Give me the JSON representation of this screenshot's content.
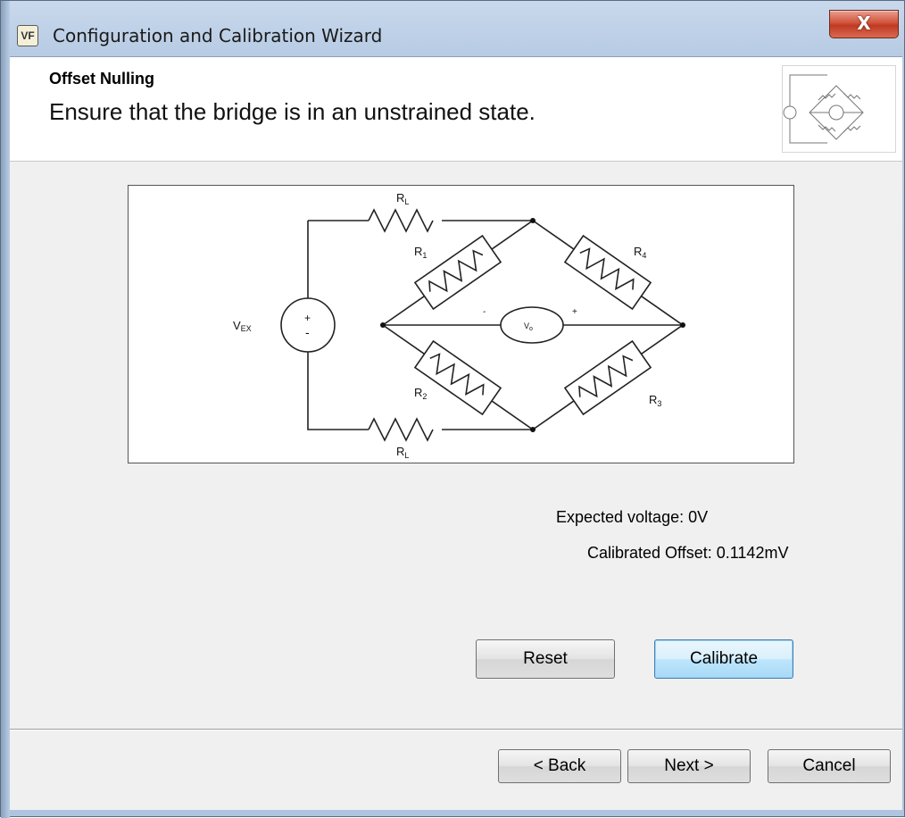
{
  "window": {
    "title": "Configuration and Calibration Wizard",
    "app_icon_label": "VF",
    "close_glyph": "X"
  },
  "header": {
    "step_title": "Offset Nulling",
    "step_description": "Ensure that the bridge is in an unstrained state."
  },
  "diagram": {
    "labels": {
      "rl_top": "R",
      "rl_top_sub": "L",
      "rl_bottom": "R",
      "rl_bottom_sub": "L",
      "r1": "R",
      "r1_sub": "1",
      "r2": "R",
      "r2_sub": "2",
      "r3": "R",
      "r3_sub": "3",
      "r4": "R",
      "r4_sub": "4",
      "vex": "V",
      "vex_sub": "EX",
      "vo": "V",
      "vo_sub": "o",
      "source_plus": "+",
      "source_minus": "-",
      "meter_minus": "-",
      "meter_plus": "+"
    }
  },
  "info": {
    "expected_voltage": "Expected voltage: 0V",
    "calibrated_offset": "Calibrated Offset: 0.1142mV"
  },
  "actions": {
    "reset": "Reset",
    "calibrate": "Calibrate"
  },
  "footer": {
    "back": "< Back",
    "next": "Next >",
    "cancel": "Cancel"
  }
}
